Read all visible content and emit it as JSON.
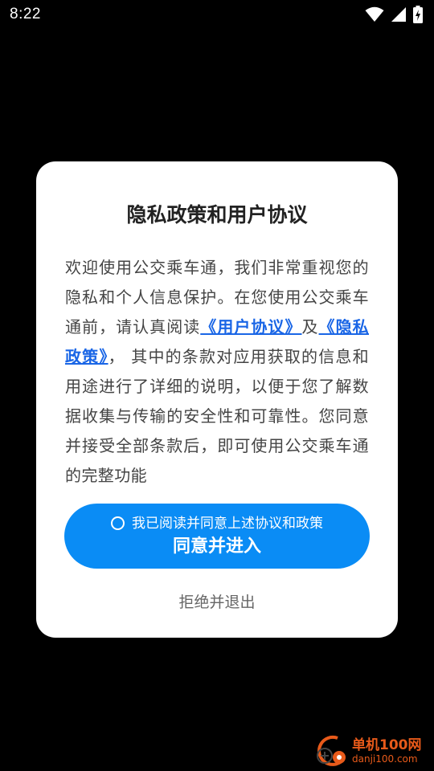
{
  "status_bar": {
    "time": "8:22",
    "icons": [
      "wifi-icon",
      "cellular-signal-icon",
      "battery-charging-icon"
    ]
  },
  "dialog": {
    "title": "隐私政策和用户协议",
    "body": {
      "text_before": "欢迎使用公交乘车通，我们非常重视您的隐私和个人信息保护。在您使用公交乘车通前，请认真阅读",
      "user_agreement_link": "《用户协议》",
      "connector": "及",
      "privacy_policy_link": "《隐私政策》",
      "text_after": "， 其中的条款对应用获取的信息和用途进行了详细的说明，以便于您了解数据收集与传输的安全性和可靠性。您同意并接受全部条款后，即可使用公交乘车通的完整功能"
    },
    "consent_label": "我已阅读并同意上述协议和政策",
    "agree_button_label": "同意并进入",
    "reject_button_label": "拒绝并退出"
  },
  "watermark": {
    "name": "单机100网",
    "url": "danji100.com"
  },
  "colors": {
    "background": "#000000",
    "dialog": "#ffffff",
    "primary_button": "#0a8cf5",
    "link": "#1a66e6",
    "watermark": "#e85a1a"
  }
}
